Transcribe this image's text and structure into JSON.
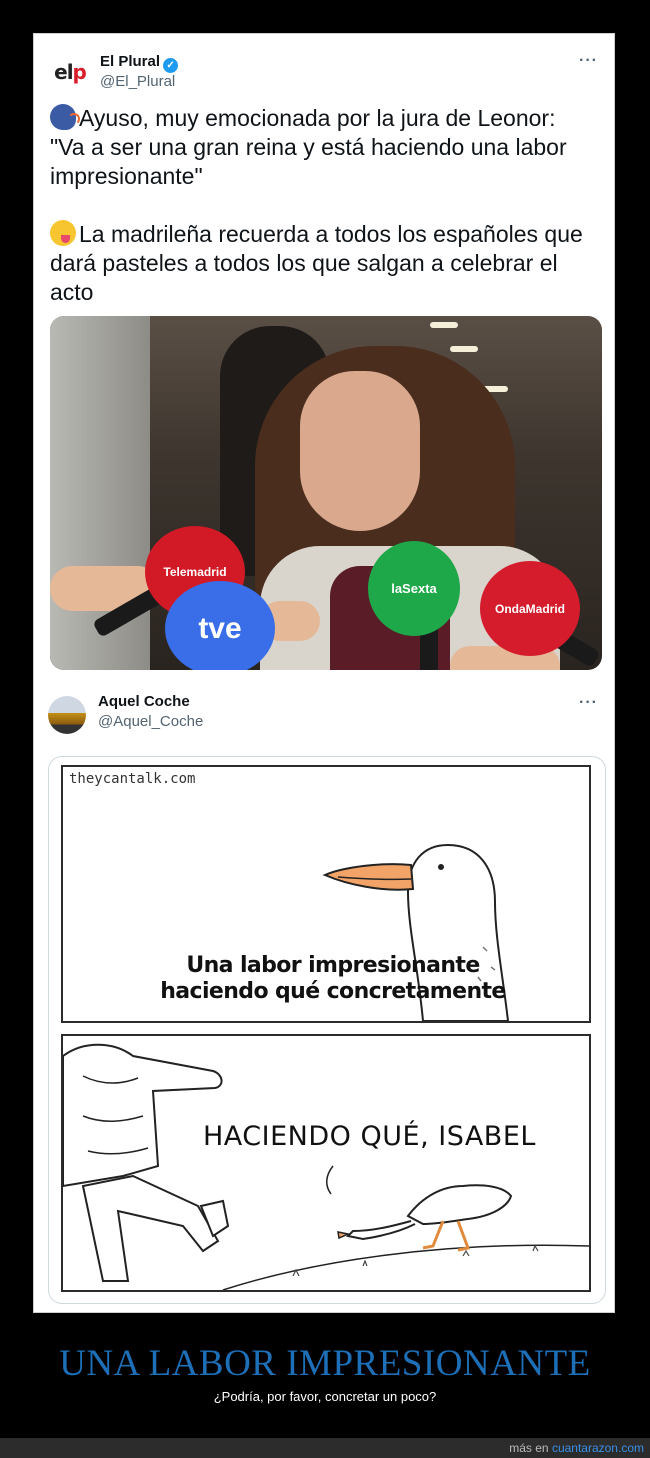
{
  "tweet1": {
    "display_name": "El Plural",
    "handle": "@El_Plural",
    "avatar_text_a": "el",
    "avatar_text_b": "p",
    "more_label": "···",
    "line1": "Ayuso, muy emocionada por la jura de Leonor:",
    "line2": "\"Va a ser una gran reina y está haciendo una labor impresionante\"",
    "line3": "La madrileña recuerda a todos los españoles que dará pasteles a todos los que salgan a celebrar el acto",
    "emoji1": "speaking-head-icon",
    "emoji2": "yum-face-icon",
    "mic_labels": {
      "telemadrid": "Telemadrid",
      "tve": "tve",
      "lasexta": "laSexta",
      "onda_madrid": "OndaMadrid"
    }
  },
  "tweet2": {
    "display_name": "Aquel Coche",
    "handle": "@Aquel_Coche",
    "more_label": "···",
    "comic": {
      "credit": "theycantalk.com",
      "caption1_line1": "Una labor impresionante",
      "caption1_line2": "haciendo qué concretamente",
      "caption2": "HACIENDO QUÉ, ISABEL"
    }
  },
  "footer": {
    "title": "UNA LABOR IMPRESIONANTE",
    "subtitle": "¿Podría, por favor, concretar un poco?",
    "more_prefix": "más en",
    "site": "cuantarazon.com"
  },
  "colors": {
    "title_blue": "#1d6fb8",
    "link_blue": "#3a8ee6",
    "verified_blue": "#1d9bf0"
  }
}
